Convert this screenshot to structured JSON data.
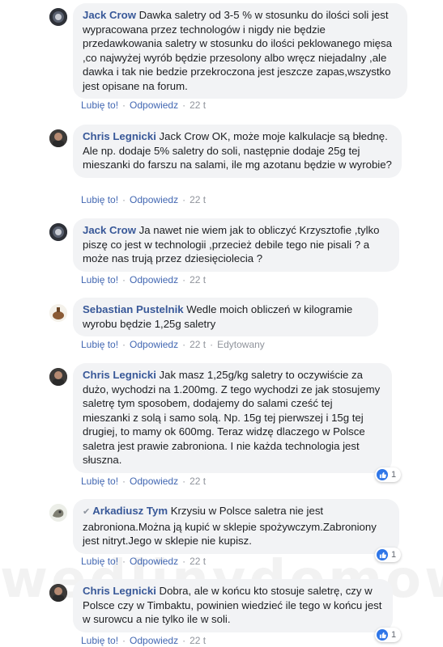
{
  "common": {
    "like": "Lubię to!",
    "reply": "Odpowiedz",
    "dot": "·",
    "edited": "Edytowany"
  },
  "comments": [
    {
      "author": "Jack Crow",
      "text": "Dawka saletry od 3-5 % w stosunku do ilości soli jest wypracowana przez technologów i nigdy nie będzie przedawkowania saletry w stosunku do ilości peklowanego mięsa ,co najwyżej wyrób będzie przesolony albo wręcz niejadalny ,ale dawka i tak nie bedzie przekroczona jest jeszcze zapas,wszystko jest opisane na forum.",
      "time": "22 t"
    },
    {
      "author": "Chris Legnicki",
      "text": "Jack Crow OK, może moje kalkulacje są błednę. Ale np. dodaje 5% saletry do soli, następnie dodaje 25g tej mieszanki do farszu na salami, ile mg azotanu będzie w wyrobie?",
      "time": "22 t"
    },
    {
      "author": "Jack Crow",
      "text": "Ja nawet nie wiem jak to obliczyć Krzysztofie ,tylko piszę co jest w technologii ,przecież debile tego nie pisali ? a może nas trują przez dziesięciolecia ?",
      "time": "22 t"
    },
    {
      "author": "Sebastian Pustelnik",
      "text": "Wedle moich obliczeń w kilogramie wyrobu będzie 1,25g saletry",
      "time": "22 t"
    },
    {
      "author": "Chris Legnicki",
      "text": "Jak masz 1,25g/kg saletry to oczywiście za dużo, wychodzi na 1.200mg. Z tego wychodzi ze jak stosujemy saletrę tym sposobem, dodajemy do salami cześć tej mieszanki z solą i samo solą. Np. 15g tej pierwszej i 15g tej drugiej, to mamy ok 600mg. Teraz widzę dlaczego w Polsce saletra jest prawie zabroniona. I nie każda technologia jest słuszna.",
      "time": "22 t",
      "reactions": "1"
    },
    {
      "author": "Arkadiusz Tym",
      "text": "Krzysiu w Polsce saletra nie jest zabroniona.Można ją kupić w sklepie spożywczym.Zabroniony jest nitryt.Jego w sklepie nie kupisz.",
      "time": "22 t",
      "reactions": "1"
    },
    {
      "author": "Chris Legnicki",
      "text": "Dobra, ale w końcu kto stosuje saletrę, czy w Polsce czy w Timbaktu, powinien wiedzieć ile tego w końcu jest w surowcu a nie tylko ile w soli.",
      "time": "22 t",
      "reactions": "1"
    }
  ],
  "watermark": "wedlinydomowe.pl",
  "colors": {
    "author": "#385898",
    "link": "#4267b2",
    "bubble": "#f2f3f5",
    "meta": "#90949c",
    "like_badge": "#2f76e8"
  },
  "icons": [
    "verified-badge-icon",
    "like-thumb-icon"
  ]
}
